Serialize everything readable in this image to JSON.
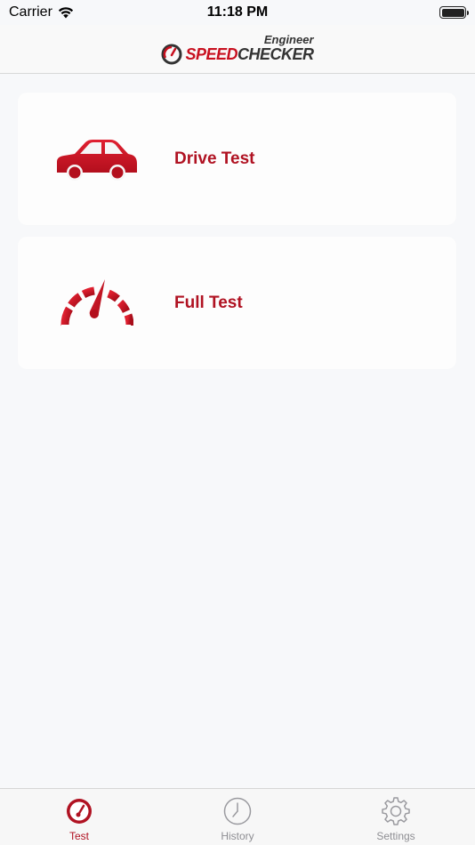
{
  "status_bar": {
    "carrier": "Carrier",
    "time": "11:18 PM"
  },
  "header": {
    "logo_superscript": "Engineer",
    "logo_speed": "SPEED",
    "logo_checker": "CHECKER"
  },
  "cards": [
    {
      "label": "Drive Test",
      "icon": "car-icon"
    },
    {
      "label": "Full Test",
      "icon": "speedometer-icon"
    }
  ],
  "tab_bar": {
    "items": [
      {
        "label": "Test",
        "icon": "speedometer-tab-icon",
        "active": true
      },
      {
        "label": "History",
        "icon": "clock-icon",
        "active": false
      },
      {
        "label": "Settings",
        "icon": "gear-icon",
        "active": false
      }
    ]
  },
  "colors": {
    "accent": "#b01222",
    "inactive": "#8e8e93",
    "background": "#f7f8fa"
  }
}
